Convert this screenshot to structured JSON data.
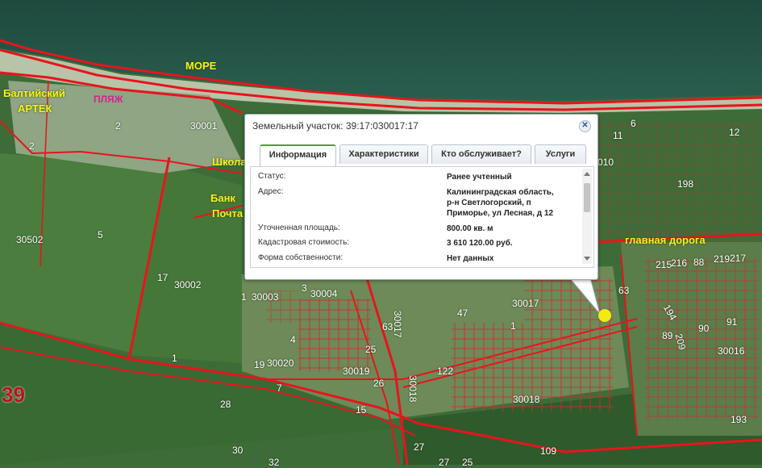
{
  "map": {
    "labels": {
      "sea": "МОРЕ",
      "baltic": "Балтийский",
      "artek": "АРТЕК",
      "beach": "ПЛЯЖ",
      "school": "Школа",
      "bank": "Банк",
      "post": "Почта",
      "main_road": "главная дорога"
    },
    "regions": {
      "r30001": "30001",
      "r30502": "30502",
      "r30002": "30002",
      "r30003": "30003",
      "r30004": "30004",
      "r30020": "30020",
      "r30019": "30019",
      "r30017a": "30017",
      "r30017b": "30017",
      "r30018": "30018",
      "r30016": "30016",
      "r30010": "010",
      "r30018v": "30018",
      "big39": "39"
    },
    "numbers": {
      "n2a": "2",
      "n2b": "2",
      "n5": "5",
      "n17": "17",
      "n1a": "1",
      "n1b": "1",
      "n3": "3",
      "n4": "4",
      "n19": "19",
      "n25": "25",
      "n26": "26",
      "n63a": "63",
      "n63b": "63",
      "n47": "47",
      "n1c": "1",
      "n122": "122",
      "n7": "7",
      "n28": "28",
      "n15": "15",
      "n30": "30",
      "n27a": "27",
      "n27b": "27",
      "n25b": "25",
      "n109": "109",
      "n193": "193",
      "n6": "6",
      "n11": "11",
      "n12": "12",
      "n198": "198",
      "n215": "215",
      "n216": "216",
      "n88": "88",
      "n219": "219",
      "n217": "217",
      "n89": "89",
      "n90": "90",
      "n91": "91",
      "n209": "209",
      "n194": "194",
      "n122b": "122",
      "n32": "32"
    }
  },
  "popup": {
    "title": "Земельный участок: 39:17:030017:17",
    "close_icon": "close-icon",
    "tabs": [
      {
        "label": "Информация",
        "active": true
      },
      {
        "label": "Характеристики",
        "active": false
      },
      {
        "label": "Кто обслуживает?",
        "active": false
      },
      {
        "label": "Услуги",
        "active": false
      }
    ],
    "rows": [
      {
        "label": "Статус:",
        "value": "Ранее учтенный"
      },
      {
        "label": "Адрес:",
        "value_lines": [
          "Калининградская область,",
          "р-н Светлогорский, п",
          "Приморье, ул Лесная, д 12"
        ]
      },
      {
        "label": "Уточненная площадь:",
        "value": "800.00 кв. м"
      },
      {
        "label": "Кадастровая стоимость:",
        "value": "3 610 120.00 руб."
      },
      {
        "label": "Форма собственности:",
        "value": "Нет данных"
      }
    ]
  },
  "colors": {
    "boundary": "#e8141c",
    "parcel": "#d92a2a",
    "marker": "#f3ea14",
    "active_tab": "#4f9d3d"
  }
}
